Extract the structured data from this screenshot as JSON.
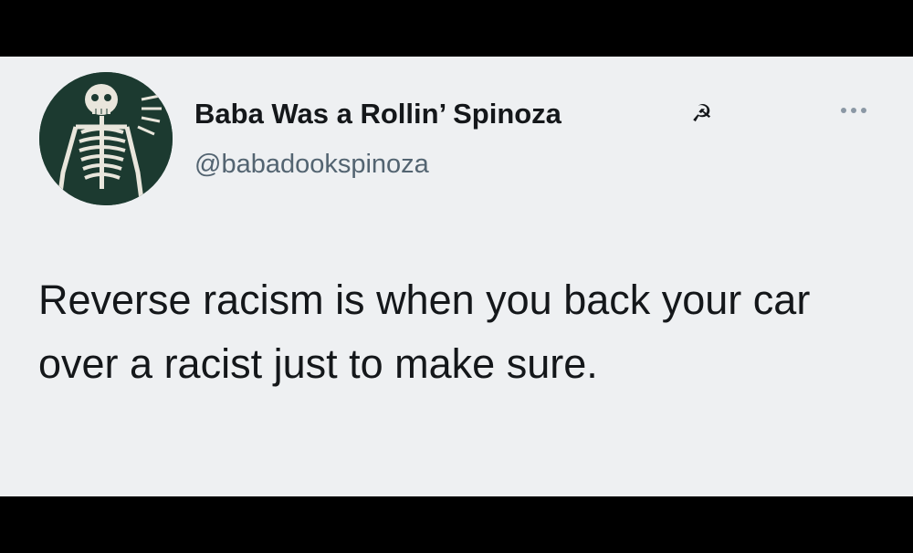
{
  "tweet": {
    "display_name": "Baba Was a Rollin’ Spinoza",
    "name_emoji": "☭",
    "handle": "@babadookspinoza",
    "text": "Reverse racism is when you back your car over a racist just to make sure.",
    "avatar_icon": "skeleton-avatar-icon",
    "more_icon": "more-options-icon"
  },
  "colors": {
    "background": "#eef0f2",
    "text": "#14171a",
    "secondary": "#536471",
    "avatar_bg": "#1c3a30"
  }
}
